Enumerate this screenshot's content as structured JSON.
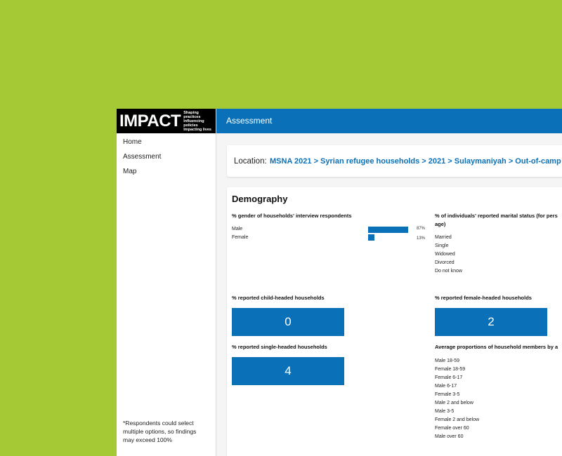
{
  "sidebar": {
    "logo": {
      "word": "IMPACT",
      "tagline": [
        "Shaping practices",
        "Influencing policies",
        "Impacting lives"
      ]
    },
    "nav": [
      {
        "label": "Home"
      },
      {
        "label": "Assessment"
      },
      {
        "label": "Map"
      }
    ],
    "footnote": "*Respondents could select multiple options, so findings may exceed 100%"
  },
  "header": {
    "title": "Assessment"
  },
  "location": {
    "label": "Location:",
    "path": "MSNA 2021 > Syrian refugee households > 2021 > Sulaymaniyah > Out-of-camp"
  },
  "demography": {
    "title": "Demography",
    "gender": {
      "title": "% gender of households' interview respondents",
      "rows": [
        {
          "label": "Male",
          "value": 87,
          "display": "87%"
        },
        {
          "label": "Female",
          "value": 13,
          "display": "13%"
        }
      ],
      "bar_color": "#0a71b8"
    },
    "marital": {
      "title_line1": "% of individuals' reported marital status (for pers",
      "title_line2": "age)",
      "rows": [
        "Married",
        "Single",
        "Widowed",
        "Divorced",
        "Do not know"
      ]
    },
    "child_headed": {
      "title": "% reported child-headed households",
      "value": "0"
    },
    "female_headed": {
      "title": "% reported female-headed households",
      "value": "2"
    },
    "single_headed": {
      "title": "% reported single-headed households",
      "value": "4"
    },
    "proportions": {
      "title": "Average proportions of household members by a",
      "rows": [
        "Male 18-59",
        "Female 18-59",
        "Female 6-17",
        "Male 6-17",
        "Female 3-5",
        "Male 2 and below",
        "Male 3-5",
        "Female 2 and below",
        "Female over 60",
        "Male over 60"
      ]
    }
  },
  "colors": {
    "background": "#a5c934",
    "accent": "#0a71b8"
  }
}
